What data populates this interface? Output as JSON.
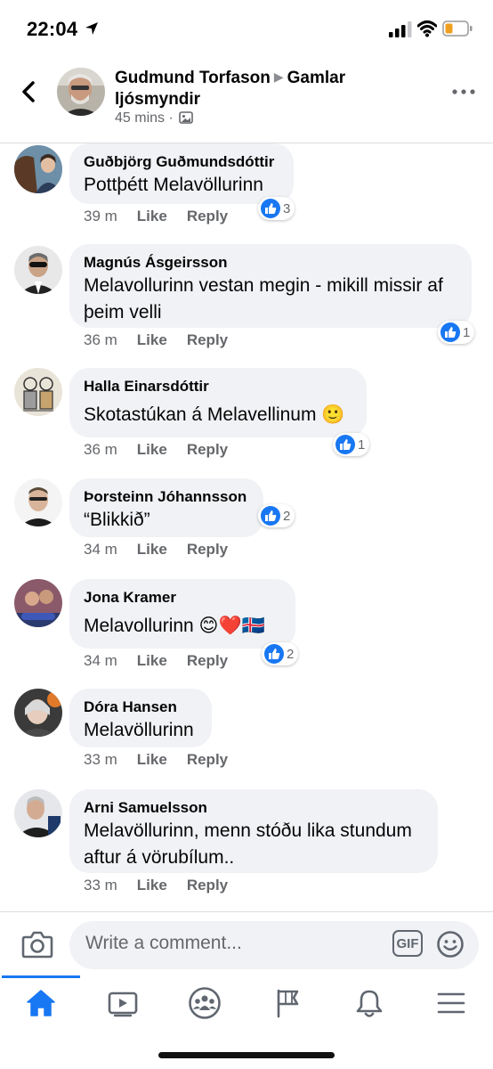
{
  "status_bar": {
    "time": "22:04"
  },
  "header": {
    "author": "Gudmund Torfason",
    "group": "Gamlar ljósmyndir",
    "age": "45 mins ·"
  },
  "comments": [
    {
      "name": "Guðbjörg Guðmundsdóttir",
      "text": "Pottþétt Melavöllurinn",
      "time": "39 m",
      "like": "Like",
      "reply": "Reply",
      "reactions": "3"
    },
    {
      "name": "Magnús Ásgeirsson",
      "text": "Melavollurinn vestan megin - mikill missir af þeim velli",
      "time": "36 m",
      "like": "Like",
      "reply": "Reply",
      "reactions": "1"
    },
    {
      "name": "Halla Einarsdóttir",
      "text": "Skotastúkan á Melavellinum 🙂",
      "time": "36 m",
      "like": "Like",
      "reply": "Reply",
      "reactions": "1"
    },
    {
      "name": "Þorsteinn Jóhannsson",
      "text": "“Blikkið”",
      "time": "34 m",
      "like": "Like",
      "reply": "Reply",
      "reactions": "2"
    },
    {
      "name": "Jona Kramer",
      "text": "Melavollurinn  😊❤️🇮🇸",
      "time": "34 m",
      "like": "Like",
      "reply": "Reply",
      "reactions": "2"
    },
    {
      "name": "Dóra Hansen",
      "text": "Melavöllurinn",
      "time": "33 m",
      "like": "Like",
      "reply": "Reply",
      "reactions": ""
    },
    {
      "name": "Arni Samuelsson",
      "text": "Melavöllurinn, menn stóðu lika stundum aftur á vörubílum..",
      "time": "33 m",
      "like": "Like",
      "reply": "Reply",
      "reactions": ""
    }
  ],
  "composer": {
    "placeholder": "Write a comment...",
    "gif_label": "GIF"
  },
  "tabs": [
    {
      "icon": "home-icon",
      "active": true
    },
    {
      "icon": "video-icon",
      "active": false
    },
    {
      "icon": "groups-icon",
      "active": false
    },
    {
      "icon": "pages-flag-icon",
      "active": false
    },
    {
      "icon": "notifications-bell-icon",
      "active": false
    },
    {
      "icon": "menu-icon",
      "active": false
    }
  ],
  "colors": {
    "accent": "#1877f2",
    "bubble": "#f0f2f5",
    "secondary_text": "#65676b"
  }
}
